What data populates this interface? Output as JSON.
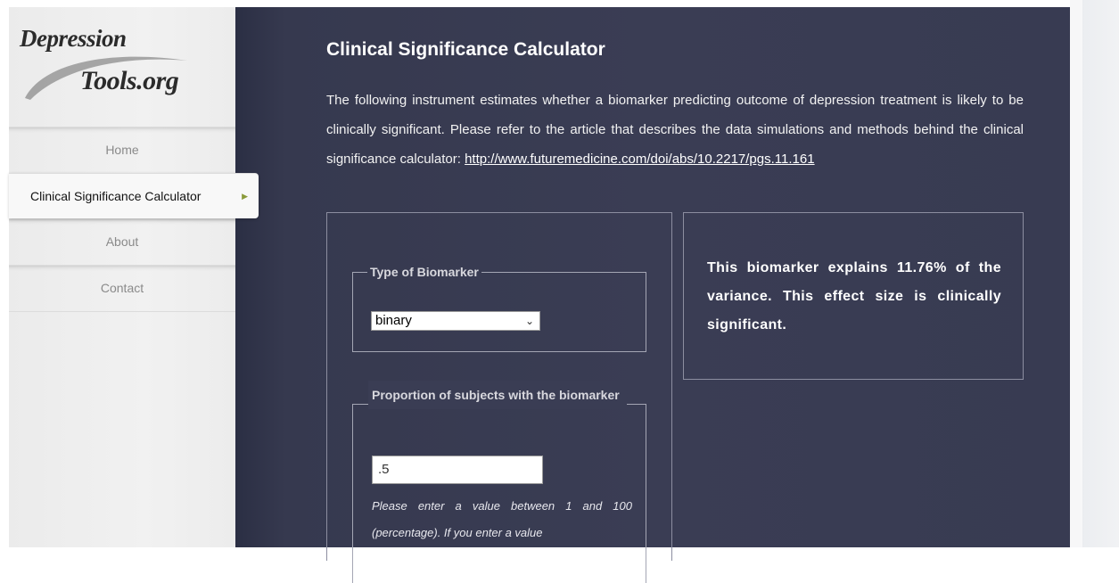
{
  "logo": {
    "line1": "Depression",
    "line2": "Tools.org"
  },
  "nav": {
    "items": [
      {
        "label": "Home"
      },
      {
        "label": "Clinical Significance Calculator"
      },
      {
        "label": "About"
      },
      {
        "label": "Contact"
      }
    ],
    "active_index": 1
  },
  "page": {
    "title": "Clinical Significance Calculator",
    "intro": "The following instrument estimates whether a biomarker predicting outcome of depression treatment is likely to be clinically significant. Please refer to the article that describes the data simulations and methods behind the clinical significance calculator:",
    "link": "http://www.futuremedicine.com/doi/abs/10.2217/pgs.11.161"
  },
  "form": {
    "biomarker_type": {
      "legend": "Type of Biomarker",
      "selected": "binary"
    },
    "proportion": {
      "legend": "Proportion of subjects with the biomarker",
      "value": ".5",
      "hint": "Please enter a value between 1 and 100 (percentage). If you enter a value"
    }
  },
  "result": {
    "text": "This biomarker explains 11.76% of the variance. This effect size is clinically significant."
  }
}
